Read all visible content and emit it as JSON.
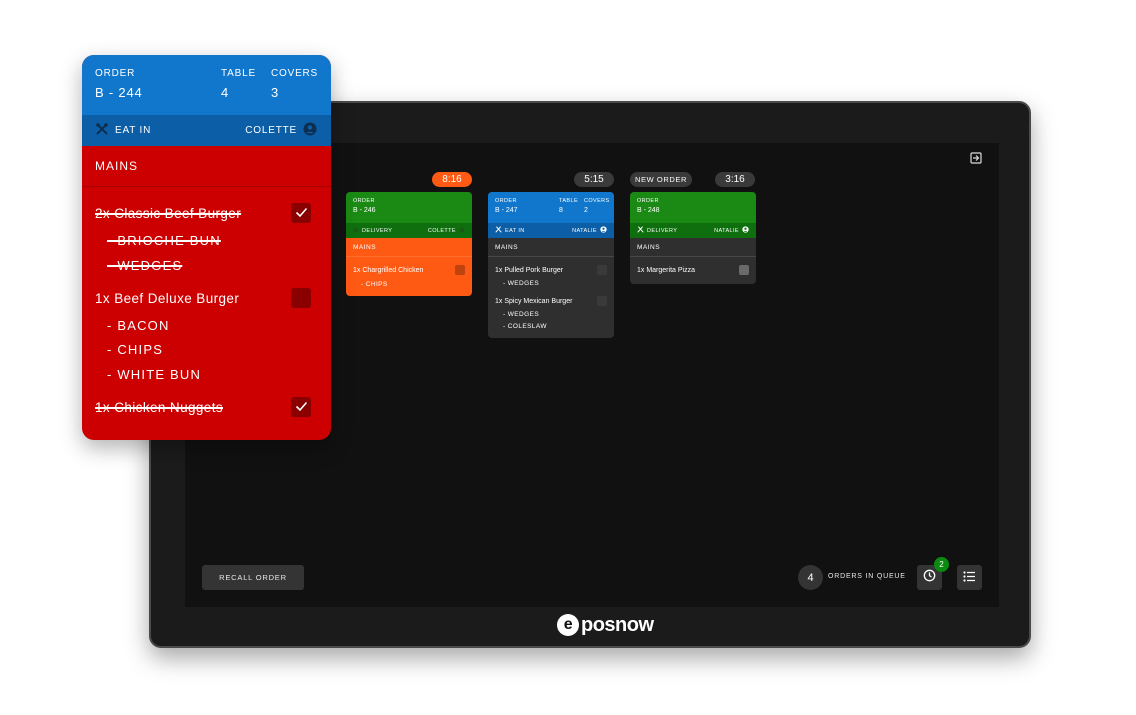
{
  "brand": {
    "logo_text": "posnow",
    "logo_letter": "e"
  },
  "labels": {
    "order": "ORDER",
    "table": "TABLE",
    "covers": "COVERS"
  },
  "featured_ticket": {
    "order_number": "B - 244",
    "table": "4",
    "covers": "3",
    "service": "EAT IN",
    "staff": "COLETTE",
    "section": "MAINS",
    "items": [
      {
        "label": "2x Classic Beef Burger",
        "done": true,
        "modifiers": [
          "- BRIOCHE BUN",
          "- WEDGES"
        ]
      },
      {
        "label": "1x Beef Deluxe Burger",
        "done": false,
        "modifiers": [
          "- BACON",
          "- CHIPS",
          "- WHITE BUN"
        ]
      },
      {
        "label": "1x Chicken Nuggets",
        "done": true,
        "modifiers": []
      }
    ],
    "colors": {
      "header": "#1177cc",
      "body": "#cc0000"
    }
  },
  "tickets": [
    {
      "timer": "8:16",
      "timer_alert": true,
      "order_number": "B - 246",
      "service": "DELIVERY",
      "staff": "COLETTE",
      "section": "MAINS",
      "items": [
        {
          "label": "1x Chargrilled Chicken",
          "modifiers": [
            "- CHIPS"
          ]
        }
      ]
    },
    {
      "timer": "5:15",
      "timer_alert": false,
      "order_number": "B - 247",
      "table": "8",
      "covers": "2",
      "service": "EAT IN",
      "staff": "NATALIE",
      "section": "MAINS",
      "items": [
        {
          "label": "1x Pulled Pork Burger",
          "modifiers": [
            "- WEDGES"
          ]
        },
        {
          "label": "1x Spicy Mexican Burger",
          "modifiers": [
            "- WEDGES",
            "- COLESLAW"
          ]
        }
      ]
    },
    {
      "timer": "3:16",
      "timer_alert": false,
      "badge": "NEW ORDER",
      "order_number": "B - 248",
      "service": "DELIVERY",
      "staff": "NATALIE",
      "section": "MAINS",
      "items": [
        {
          "label": "1x Margerita Pizza",
          "modifiers": []
        }
      ]
    }
  ],
  "footer": {
    "recall_label": "RECALL ORDER",
    "queue_count": "4",
    "queue_label": "ORDERS IN QUEUE",
    "clock_badge": "2"
  },
  "icons": [
    "exit-icon",
    "cutlery-icon",
    "delivery-icon",
    "user-icon",
    "check-icon",
    "clock-icon",
    "list-icon"
  ]
}
